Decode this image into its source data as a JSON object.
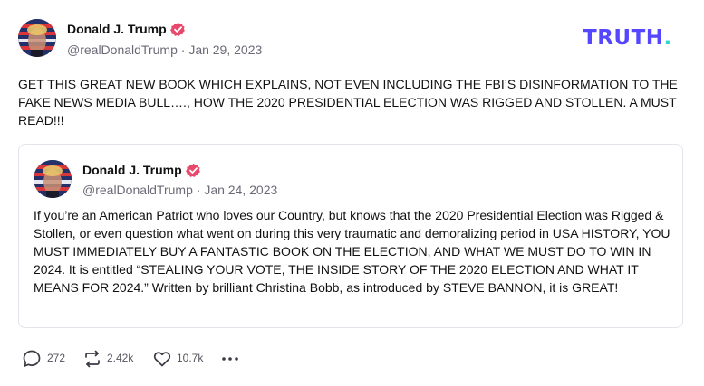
{
  "brand": {
    "logo_text": "TRUTH",
    "logo_dot": ".",
    "primary_color": "#5447ff",
    "accent_color": "#2fd8c4"
  },
  "post": {
    "author_name": "Donald J. Trump",
    "handle": "@realDonaldTrump",
    "separator": "·",
    "date": "Jan 29, 2023",
    "verified_icon": "verified-badge-icon",
    "text": "GET THIS GREAT NEW BOOK WHICH EXPLAINS, NOT EVEN INCLUDING THE FBI’S DISINFORMATION TO THE FAKE NEWS MEDIA BULL…., HOW THE 2020 PRESIDENTIAL ELECTION WAS RIGGED AND STOLLEN. A MUST READ!!!"
  },
  "quoted_post": {
    "author_name": "Donald J. Trump",
    "handle": "@realDonaldTrump",
    "separator": "·",
    "date": "Jan 24, 2023",
    "verified_icon": "verified-badge-icon",
    "text": "If you’re an American Patriot who loves our Country, but knows that the 2020 Presidential Election was Rigged & Stollen, or even question what went on during this very traumatic and demoralizing period in USA HISTORY, YOU MUST IMMEDIATELY BUY A FANTASTIC BOOK ON THE ELECTION, AND WHAT WE MUST DO TO WIN IN 2024. It is entitled “STEALING YOUR VOTE, THE INSIDE STORY OF THE 2020 ELECTION AND WHAT IT MEANS FOR 2024.” Written by brilliant Christina Bobb, as introduced by STEVE BANNON, it is GREAT!"
  },
  "actions": {
    "replies": {
      "icon": "reply-icon",
      "count": "272"
    },
    "retruths": {
      "icon": "retruth-icon",
      "count": "2.42k"
    },
    "likes": {
      "icon": "heart-icon",
      "count": "10.7k"
    },
    "more": {
      "icon": "more-dots-icon"
    }
  }
}
